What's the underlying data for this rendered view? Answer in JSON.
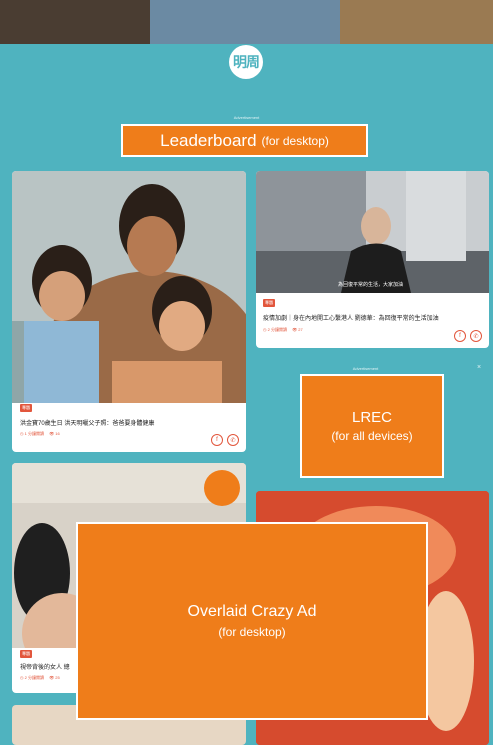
{
  "header": {
    "logo_text": "明周"
  },
  "ads": {
    "advertisement_label": "Advertisement",
    "leaderboard": {
      "title": "Leaderboard",
      "subtitle": "(for desktop)"
    },
    "lrec": {
      "title": "LREC",
      "subtitle": "(for all devices)",
      "close": "×"
    },
    "crazy": {
      "title": "Overlaid Crazy Ad",
      "subtitle": "(for desktop)"
    }
  },
  "articles": [
    {
      "badge": "專題",
      "title": "洪金寶70歲生日 洪天明曬父子照：爸爸要身體健康",
      "meta": "1 分鐘閱讀",
      "views": "16"
    },
    {
      "badge": "專題",
      "title": "疫情加劇｜身在內地開工心繫港人 劉德華：為回復平常的生活加油",
      "meta": "2 分鐘閱讀",
      "views": "27",
      "subtitle_overlay": "為回復平常的生活，大家加油"
    },
    {
      "badge": "專題",
      "title": "視帝背後的女人 總",
      "meta": "2 分鐘閱讀",
      "views": "25"
    }
  ],
  "icons": {
    "facebook": "f",
    "whatsapp": "✆",
    "clock": "◷",
    "eye": "👁"
  },
  "colors": {
    "teal": "#4fb3bf",
    "orange": "#ef7d1a",
    "red": "#e2563c"
  }
}
